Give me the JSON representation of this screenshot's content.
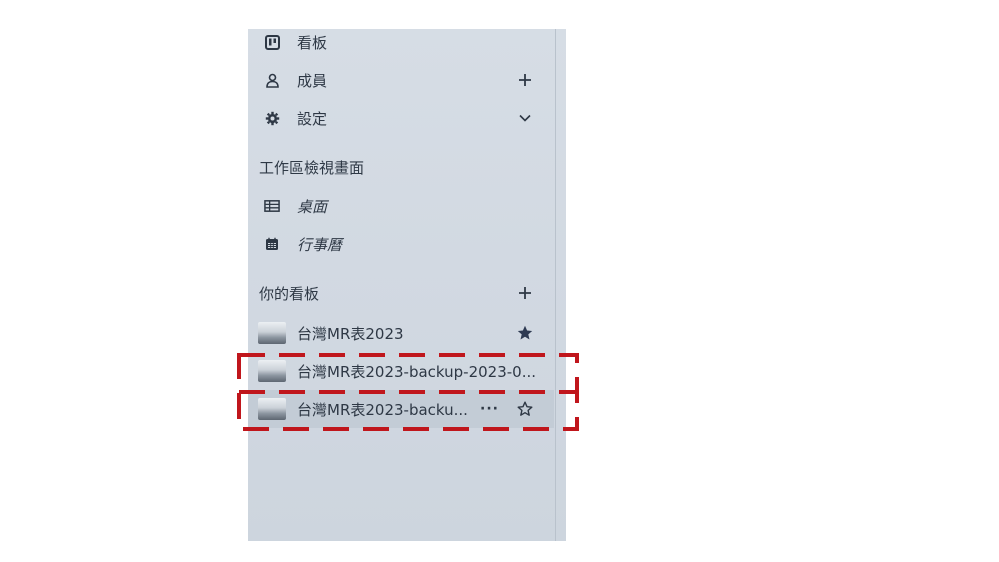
{
  "sidebar": {
    "workspace_items": [
      {
        "label": "看板",
        "icon": "board-icon"
      },
      {
        "label": "成員",
        "icon": "person-icon",
        "action": "plus-icon"
      },
      {
        "label": "設定",
        "icon": "gear-icon",
        "action": "chevron-down-icon"
      }
    ],
    "views_title": "工作區檢視畫面",
    "views": [
      {
        "label": "桌面",
        "icon": "table-icon"
      },
      {
        "label": "行事曆",
        "icon": "calendar-icon"
      }
    ],
    "boards_title": "你的看板",
    "boards": [
      {
        "label": "台灣MR表2023",
        "starred": true
      },
      {
        "label": "台灣MR表2023-backup-2023-0...",
        "starred": false
      },
      {
        "label": "台灣MR表2023-backu...",
        "starred": false,
        "more": "···"
      }
    ]
  },
  "colors": {
    "sidebar_bg": "#d4dbe3",
    "highlight": "#c0161c",
    "text": "#2e3845"
  }
}
